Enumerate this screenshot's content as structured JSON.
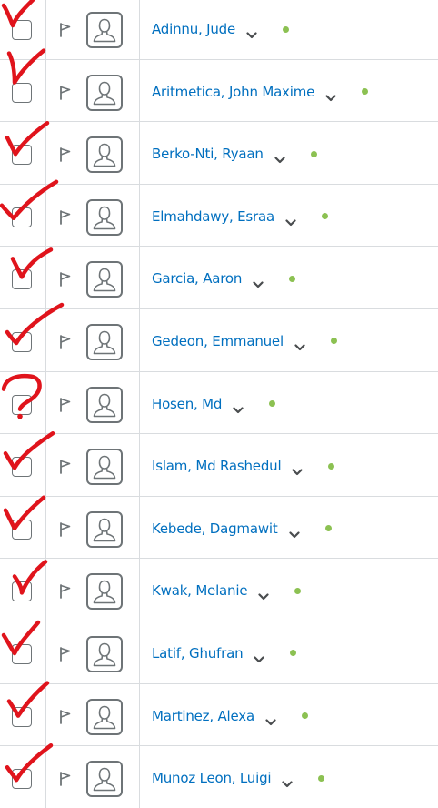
{
  "colors": {
    "link": "#006fbf",
    "online_dot": "#8cc152",
    "border": "#d9dcdf",
    "icon": "#6e7477",
    "annotation": "#e0141c"
  },
  "icons": {
    "flag": "flag-icon",
    "avatar": "user-avatar-icon",
    "chevron": "chevron-down-icon",
    "status": "online-status-dot"
  },
  "students": [
    {
      "name": "Adinnu, Jude",
      "annotation": "check"
    },
    {
      "name": "Aritmetica, John Maxime",
      "annotation": "check"
    },
    {
      "name": "Berko-Nti, Ryaan",
      "annotation": "check"
    },
    {
      "name": "Elmahdawy, Esraa",
      "annotation": "check"
    },
    {
      "name": "Garcia, Aaron",
      "annotation": "check"
    },
    {
      "name": "Gedeon, Emmanuel",
      "annotation": "check"
    },
    {
      "name": "Hosen, Md",
      "annotation": "question"
    },
    {
      "name": "Islam, Md Rashedul",
      "annotation": "check"
    },
    {
      "name": "Kebede, Dagmawit",
      "annotation": "check"
    },
    {
      "name": "Kwak, Melanie",
      "annotation": "check"
    },
    {
      "name": "Latif, Ghufran",
      "annotation": "check"
    },
    {
      "name": "Martinez, Alexa",
      "annotation": "check"
    },
    {
      "name": "Munoz Leon, Luigi",
      "annotation": "check"
    }
  ]
}
